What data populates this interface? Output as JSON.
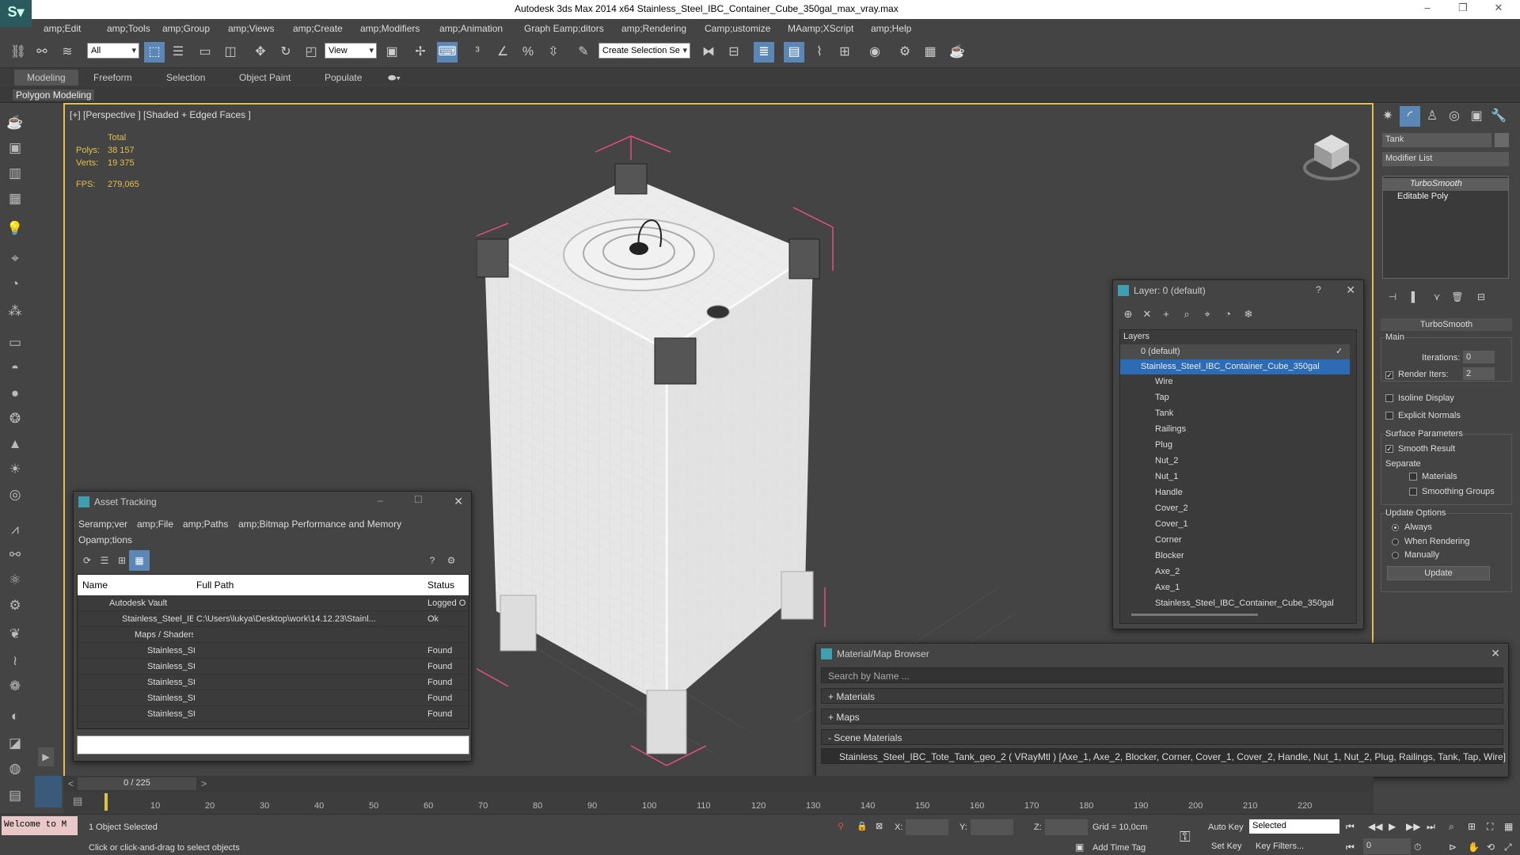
{
  "window": {
    "title": "Autodesk 3ds Max  2014 x64     Stainless_Steel_IBC_Container_Cube_350gal_max_vray.max"
  },
  "menu": [
    "amp;Edit",
    "amp;Tools",
    "amp;Group",
    "amp;Views",
    "amp;Create",
    "amp;Modifiers",
    "amp;Animation",
    "Graph Eamp;ditors",
    "amp;Rendering",
    "Camp;ustomize",
    "MAamp;XScript",
    "amp;Help"
  ],
  "toolbar": {
    "filter_select": "All",
    "view_select": "View",
    "selection_set": "Create Selection Se"
  },
  "ribbon": {
    "tabs": [
      "Modeling",
      "Freeform",
      "Selection",
      "Object Paint",
      "Populate"
    ],
    "subtab": "Polygon Modeling"
  },
  "viewport": {
    "label": "[+] [Perspective ] [Shaded + Edged Faces ]",
    "stats": {
      "total_label": "Total",
      "polys_label": "Polys:",
      "polys": "38 157",
      "verts_label": "Verts:",
      "verts": "19 375",
      "fps_label": "FPS:",
      "fps": "279,065"
    }
  },
  "command_panel": {
    "object_name": "Tank",
    "modifier_list": "Modifier List",
    "stack": [
      "TurboSmooth",
      "Editable Poly"
    ],
    "rollout_title": "TurboSmooth",
    "main_label": "Main",
    "iterations_label": "Iterations:",
    "iterations": "0",
    "render_iters_label": "Render Iters:",
    "render_iters": "2",
    "isoline": "Isoline Display",
    "explicit_normals": "Explicit Normals",
    "surface_params": "Surface Parameters",
    "smooth_result": "Smooth Result",
    "separate": "Separate",
    "materials": "Materials",
    "smoothing_groups": "Smoothing Groups",
    "update_options": "Update Options",
    "always": "Always",
    "when_rendering": "When Rendering",
    "manually": "Manually",
    "update_button": "Update"
  },
  "layers_window": {
    "title": "Layer: 0 (default)",
    "help": "?",
    "header": "Layers",
    "rows": [
      "0 (default)",
      "Stainless_Steel_IBC_Container_Cube_350gal",
      "Wire",
      "Tap",
      "Tank",
      "Railings",
      "Plug",
      "Nut_2",
      "Nut_1",
      "Handle",
      "Cover_2",
      "Cover_1",
      "Corner",
      "Blocker",
      "Axe_2",
      "Axe_1",
      "Stainless_Steel_IBC_Container_Cube_350gal"
    ]
  },
  "asset_window": {
    "title": "Asset Tracking",
    "menu": [
      "Seramp;ver",
      "amp;File",
      "amp;Paths",
      "amp;Bitmap Performance and Memory"
    ],
    "menu2": "Opamp;tions",
    "columns": [
      "Name",
      "Full Path",
      "Status"
    ],
    "rows": [
      {
        "name": "Autodesk Vault",
        "path": "",
        "status": "Logged O"
      },
      {
        "name": "Stainless_Steel_IBC_...",
        "path": "C:\\Users\\lukya\\Desktop\\work\\14.12.23\\Stainl...",
        "status": "Ok"
      },
      {
        "name": "Maps / Shaders",
        "path": "",
        "status": ""
      },
      {
        "name": "Stainless_Steel...",
        "path": "",
        "status": "Found"
      },
      {
        "name": "Stainless_Steel...",
        "path": "",
        "status": "Found"
      },
      {
        "name": "Stainless_Steel...",
        "path": "",
        "status": "Found"
      },
      {
        "name": "Stainless_Steel...",
        "path": "",
        "status": "Found"
      },
      {
        "name": "Stainless_Steel...",
        "path": "",
        "status": "Found"
      }
    ]
  },
  "material_browser": {
    "title": "Material/Map Browser",
    "search_placeholder": "Search by Name ...",
    "sections": [
      "+ Materials",
      "+ Maps",
      "- Scene Materials"
    ],
    "scene_material": "Stainless_Steel_IBC_Tote_Tank_geo_2  ( VRayMtl )  [Axe_1, Axe_2, Blocker, Corner, Cover_1, Cover_2, Handle, Nut_1, Nut_2, Plug, Railings, Tank, Tap, Wire]"
  },
  "timeline": {
    "frame_display": "0 / 225",
    "ticks": [
      "10",
      "20",
      "30",
      "40",
      "50",
      "60",
      "70",
      "80",
      "90",
      "100",
      "110",
      "120",
      "130",
      "140",
      "150",
      "160",
      "170",
      "180",
      "190",
      "200",
      "210",
      "220"
    ]
  },
  "status": {
    "maxscript": "Welcome to M",
    "selected": "1 Object Selected",
    "prompt": "Click or click-and-drag to select objects",
    "x_label": "X:",
    "y_label": "Y:",
    "z_label": "Z:",
    "grid": "Grid = 10,0cm",
    "add_time_tag": "Add Time Tag",
    "auto_key": "Auto Key",
    "set_key": "Set Key",
    "key_mode": "Selected",
    "key_filters": "Key Filters...",
    "frame": "0"
  },
  "colors": {
    "accent": "#5b87b6",
    "selection": "#2d6bb5",
    "viewport_border": "#e3c049",
    "bbox": "#e05080"
  }
}
